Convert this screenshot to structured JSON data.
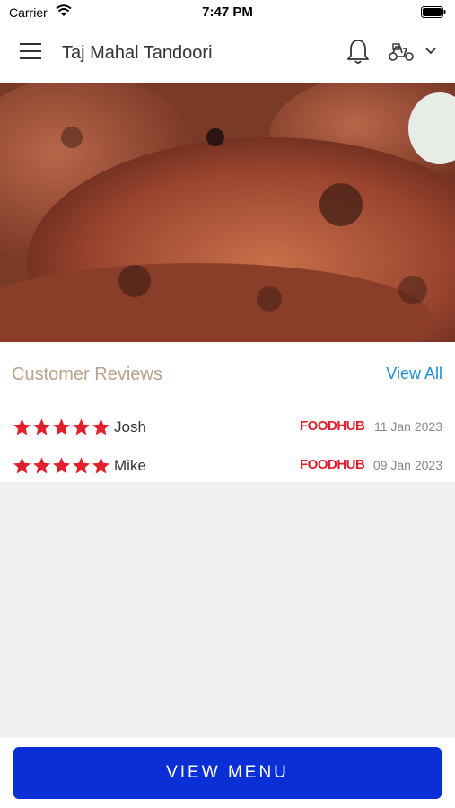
{
  "status_bar": {
    "carrier": "Carrier",
    "time": "7:47 PM"
  },
  "header": {
    "title": "Taj Mahal Tandoori"
  },
  "reviews": {
    "title": "Customer Reviews",
    "view_all_label": "View All",
    "items": [
      {
        "rating": 5,
        "name": "Josh",
        "source": "FOODHUB",
        "date": "11 Jan 2023"
      },
      {
        "rating": 5,
        "name": "Mike",
        "source": "FOODHUB",
        "date": "09 Jan 2023"
      }
    ]
  },
  "footer": {
    "view_menu_label": "VIEW MENU"
  },
  "colors": {
    "accent": "#0b2fd6",
    "star": "#e0212d",
    "link": "#1f8fce",
    "reviews_title": "#b8a38a"
  }
}
